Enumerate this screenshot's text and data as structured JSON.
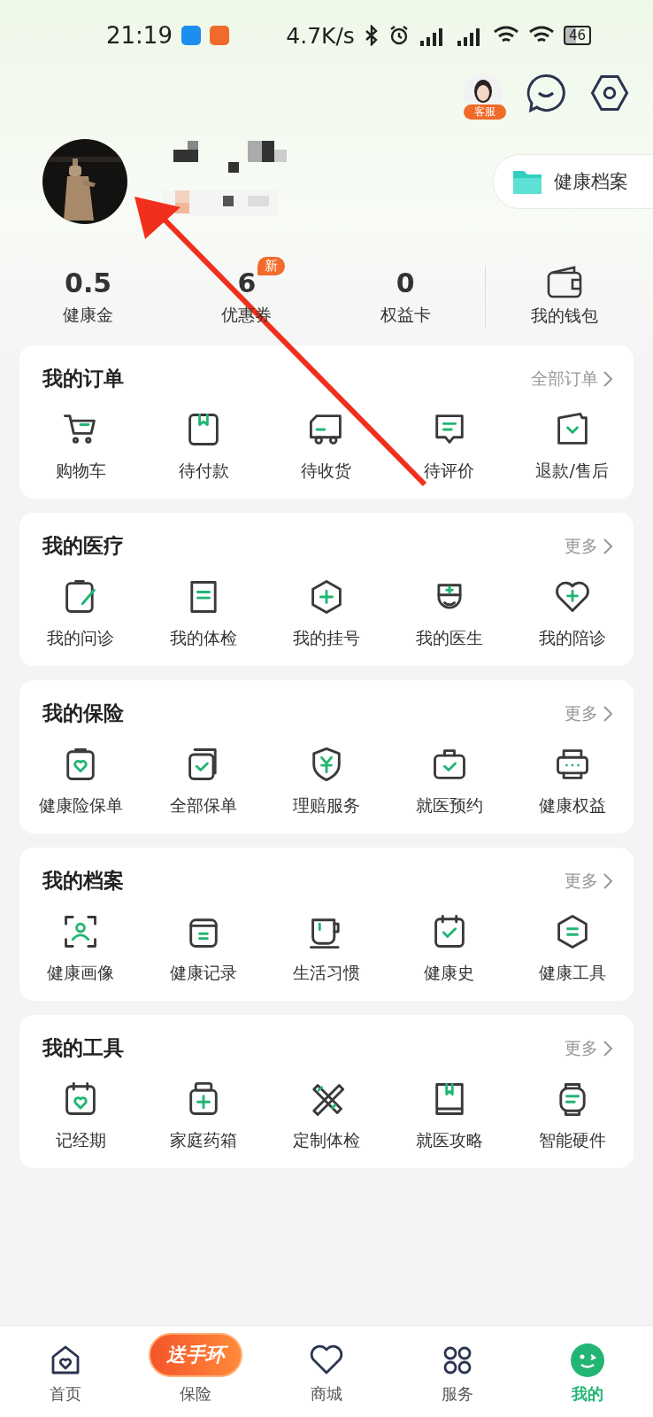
{
  "status_bar": {
    "time": "21:19",
    "speed": "4.7K/s",
    "battery": "46"
  },
  "header": {
    "service_badge": "客服",
    "archive_button": "健康档案"
  },
  "stats": [
    {
      "value": "0.5",
      "label": "健康金"
    },
    {
      "value": "6",
      "label": "优惠券",
      "badge": "新"
    },
    {
      "value": "0",
      "label": "权益卡"
    }
  ],
  "wallet": {
    "label": "我的钱包"
  },
  "sections": [
    {
      "title": "我的订单",
      "more": "全部订单",
      "items": [
        "购物车",
        "待付款",
        "待收货",
        "待评价",
        "退款/售后"
      ]
    },
    {
      "title": "我的医疗",
      "more": "更多",
      "items": [
        "我的问诊",
        "我的体检",
        "我的挂号",
        "我的医生",
        "我的陪诊"
      ]
    },
    {
      "title": "我的保险",
      "more": "更多",
      "items": [
        "健康险保单",
        "全部保单",
        "理赔服务",
        "就医预约",
        "健康权益"
      ]
    },
    {
      "title": "我的档案",
      "more": "更多",
      "items": [
        "健康画像",
        "健康记录",
        "生活习惯",
        "健康史",
        "健康工具"
      ]
    },
    {
      "title": "我的工具",
      "more": "更多",
      "items": [
        "记经期",
        "家庭药箱",
        "定制体检",
        "就医攻略",
        "智能硬件"
      ]
    }
  ],
  "tab_bar": [
    {
      "label": "首页",
      "selected": false
    },
    {
      "label": "保险",
      "selected": false,
      "promo": "送手环"
    },
    {
      "label": "商城",
      "selected": false
    },
    {
      "label": "服务",
      "selected": false
    },
    {
      "label": "我的",
      "selected": true
    }
  ]
}
